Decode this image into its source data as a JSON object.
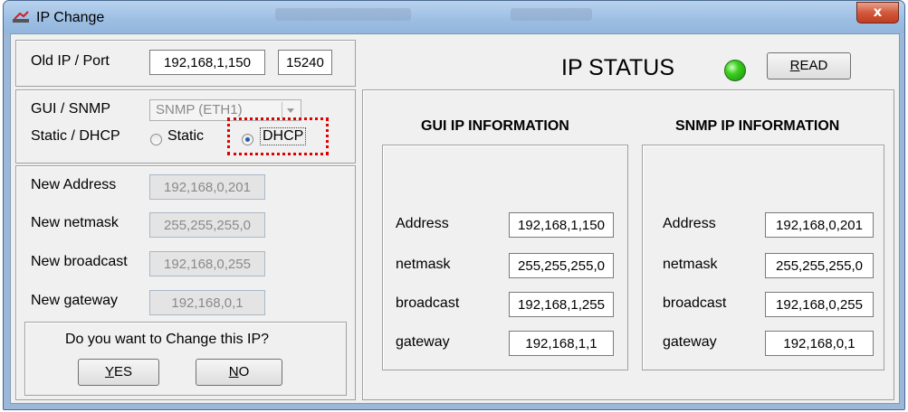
{
  "window": {
    "title": "IP Change",
    "close_symbol": "x"
  },
  "old": {
    "label": "Old IP / Port",
    "ip": "192,168,1,150",
    "port": "15240"
  },
  "status": {
    "title": "IP STATUS",
    "led_color": "#3cd020",
    "read_label": "READ",
    "read_hotkey": "R",
    "read_rest": "EAD"
  },
  "mode": {
    "gui_snmp_label": "GUI / SNMP",
    "gui_snmp_value": "SNMP (ETH1)",
    "static_dhcp_label": "Static / DHCP",
    "static_label": "Static",
    "dhcp_label": "DHCP",
    "selected": "DHCP",
    "highlight_color": "#e00000"
  },
  "new": {
    "address_label": "New Address",
    "address": "192,168,0,201",
    "netmask_label": "New netmask",
    "netmask": "255,255,255,0",
    "broadcast_label": "New broadcast",
    "broadcast": "192,168,0,255",
    "gateway_label": "New gateway",
    "gateway": "192,168,0,1"
  },
  "confirm": {
    "question": "Do you want to Change this IP?",
    "yes_hotkey": "Y",
    "yes_rest": "ES",
    "no_hotkey": "N",
    "no_rest": "O"
  },
  "gui": {
    "heading": "GUI IP INFORMATION",
    "address_label": "Address",
    "address": "192,168,1,150",
    "netmask_label": "netmask",
    "netmask": "255,255,255,0",
    "broadcast_label": "broadcast",
    "broadcast": "192,168,1,255",
    "gateway_label": "gateway",
    "gateway": "192,168,1,1"
  },
  "snmp": {
    "heading": "SNMP IP INFORMATION",
    "address_label": "Address",
    "address": "192,168,0,201",
    "netmask_label": "netmask",
    "netmask": "255,255,255,0",
    "broadcast_label": "broadcast",
    "broadcast": "192,168,0,255",
    "gateway_label": "gateway",
    "gateway": "192,168,0,1"
  }
}
